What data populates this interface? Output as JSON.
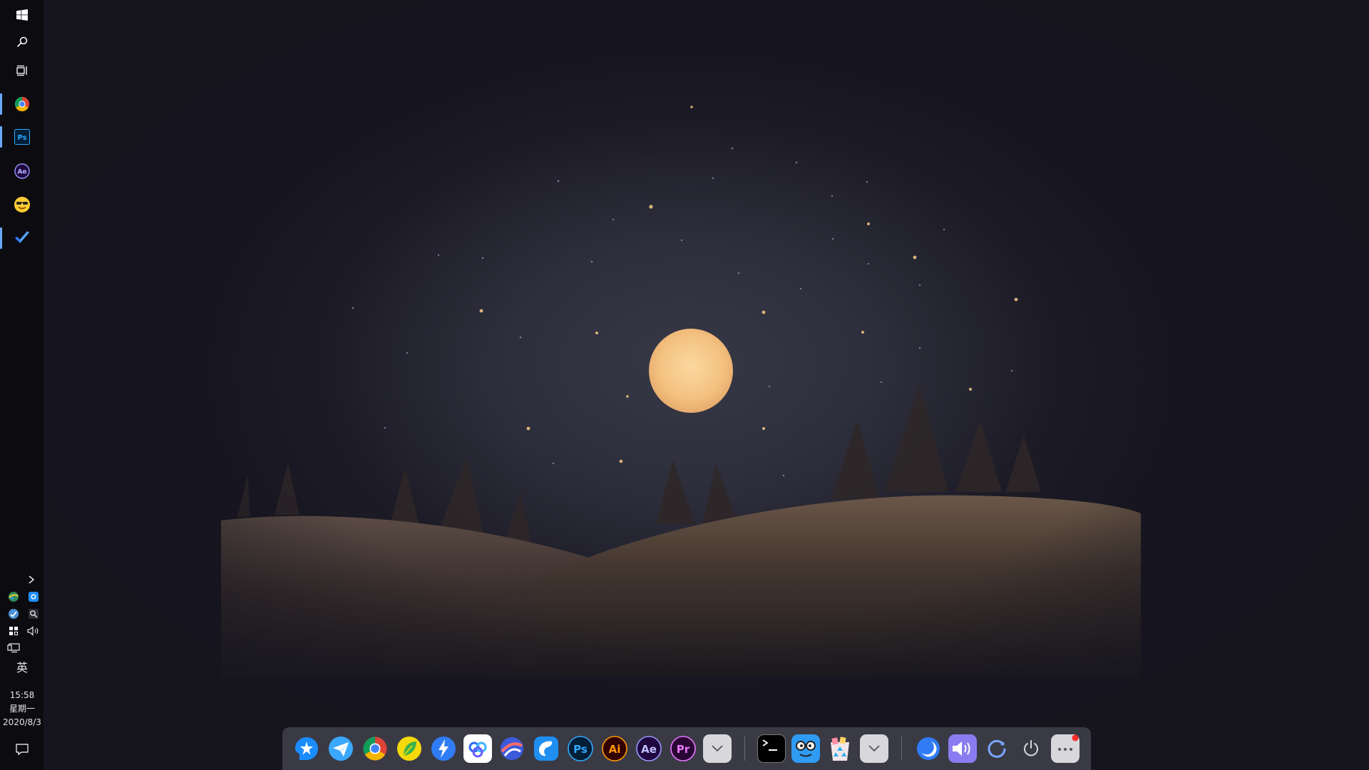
{
  "taskbar": {
    "start": {
      "icon": "windows-icon"
    },
    "search": {
      "icon": "search-icon"
    },
    "task_view": {
      "icon": "task-view-icon"
    },
    "pinned": [
      {
        "name": "chrome",
        "icon": "chrome-icon",
        "active": true
      },
      {
        "name": "photoshop",
        "icon": "photoshop-icon",
        "label": "Ps",
        "active": true
      },
      {
        "name": "after-effects",
        "icon": "after-effects-icon",
        "label": "Ae",
        "active": false
      },
      {
        "name": "emoji-app",
        "icon": "sunglasses-face-icon",
        "active": false
      },
      {
        "name": "todo",
        "icon": "checkmark-icon",
        "active": true
      }
    ],
    "tray": {
      "expand_icon": "chevron-right-icon",
      "icons": [
        "network-globe-icon",
        "cloud-app-icon",
        "shield-icon",
        "search-app-icon",
        "app-grid-icon",
        "volume-icon",
        "display-icon"
      ]
    },
    "ime_label": "英",
    "clock": {
      "time": "15:58",
      "weekday": "星期一",
      "date": "2020/8/3"
    },
    "notification_icon": "notification-icon"
  },
  "dock": {
    "apps": [
      {
        "name": "dingtalk",
        "icon": "dingtalk-icon",
        "color": "#1a8cff"
      },
      {
        "name": "feishu",
        "icon": "paper-plane-icon",
        "color": "#3aa8ff"
      },
      {
        "name": "chrome",
        "icon": "chrome-icon"
      },
      {
        "name": "leaf-app",
        "icon": "leaf-icon",
        "color": "#f5d90a"
      },
      {
        "name": "lightning-app",
        "icon": "lightning-icon",
        "color": "#2f7cf6"
      },
      {
        "name": "baidu-netdisk",
        "icon": "cloud-disk-icon",
        "color": "#ffffff"
      },
      {
        "name": "browser",
        "icon": "globe-browser-icon",
        "color": "#3b5bdb"
      },
      {
        "name": "edge-like",
        "icon": "bird-icon",
        "color": "#1f8ef1"
      },
      {
        "name": "photoshop",
        "icon": "photoshop-icon",
        "label": "Ps",
        "color": "#31a8ff"
      },
      {
        "name": "illustrator",
        "icon": "illustrator-icon",
        "label": "Ai",
        "color": "#ff9a00"
      },
      {
        "name": "after-effects",
        "icon": "after-effects-icon",
        "label": "Ae",
        "color": "#9999ff"
      },
      {
        "name": "premiere",
        "icon": "premiere-icon",
        "label": "Pr",
        "color": "#ea77ff"
      },
      {
        "name": "more-apps",
        "icon": "chevron-down-icon"
      }
    ],
    "tools": [
      {
        "name": "terminal",
        "icon": "terminal-icon"
      },
      {
        "name": "finder",
        "icon": "finder-face-icon"
      },
      {
        "name": "recycle-bin",
        "icon": "recycle-bin-icon"
      },
      {
        "name": "more-tools",
        "icon": "chevron-down-icon"
      }
    ],
    "system": [
      {
        "name": "night-mode",
        "icon": "moon-icon"
      },
      {
        "name": "volume",
        "icon": "volume-icon"
      },
      {
        "name": "refresh",
        "icon": "refresh-icon"
      },
      {
        "name": "power",
        "icon": "power-icon"
      },
      {
        "name": "menu",
        "icon": "ellipsis-icon",
        "badge": true
      }
    ]
  },
  "colors": {
    "taskbar_bg": "#0c0c10",
    "dock_bg": "#3a3a45",
    "accent": "#6aa7ff",
    "moon": "#f6c888"
  }
}
